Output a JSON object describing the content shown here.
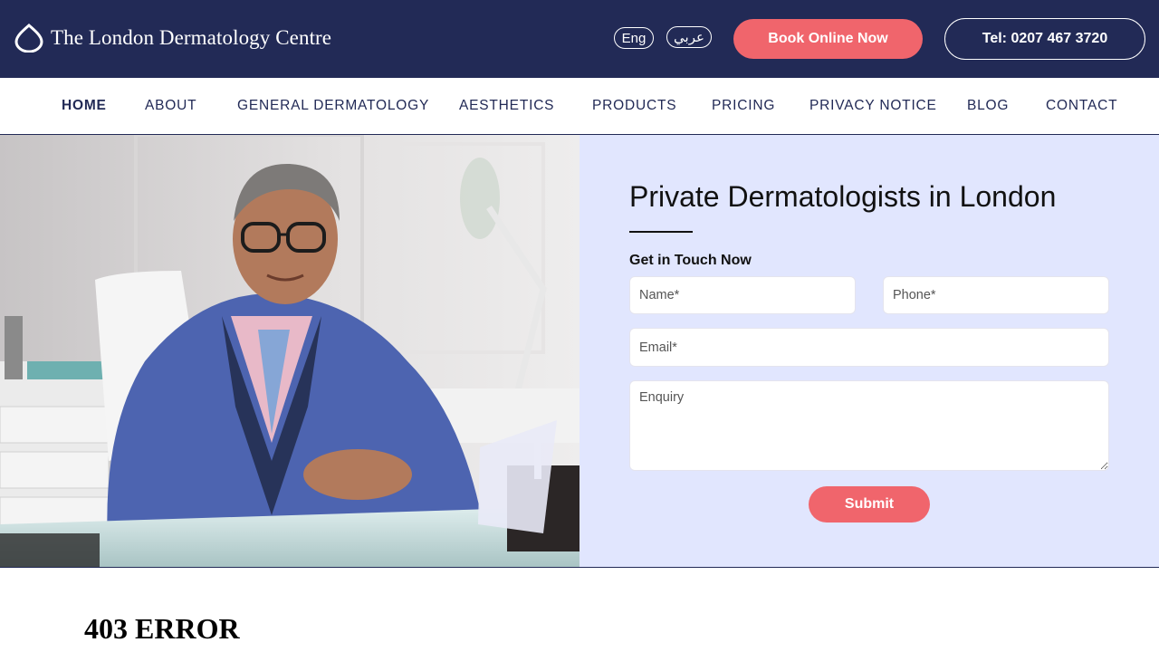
{
  "header": {
    "logo_text": "The London Dermatology Centre",
    "lang_en": "Eng",
    "lang_ar": "عربي",
    "book_label": "Book Online Now",
    "tel_label": "Tel: 0207 467 3720"
  },
  "nav": {
    "items": [
      {
        "label": "HOME",
        "active": true
      },
      {
        "label": "ABOUT"
      },
      {
        "label": "GENERAL DERMATOLOGY"
      },
      {
        "label": "AESTHETICS"
      },
      {
        "label": "PRODUCTS"
      },
      {
        "label": "PRICING"
      },
      {
        "label": "PRIVACY NOTICE"
      },
      {
        "label": "BLOG"
      },
      {
        "label": "CONTACT"
      }
    ]
  },
  "hero": {
    "title": "Private Dermatologists in London",
    "form_heading": "Get in Touch Now",
    "name_placeholder": "Name*",
    "phone_placeholder": "Phone*",
    "email_placeholder": "Email*",
    "enquiry_placeholder": "Enquiry",
    "submit_label": "Submit"
  },
  "error_text": "403 ERROR",
  "colors": {
    "navy": "#222a56",
    "coral": "#f0656c",
    "panel": "#e1e6fe"
  }
}
